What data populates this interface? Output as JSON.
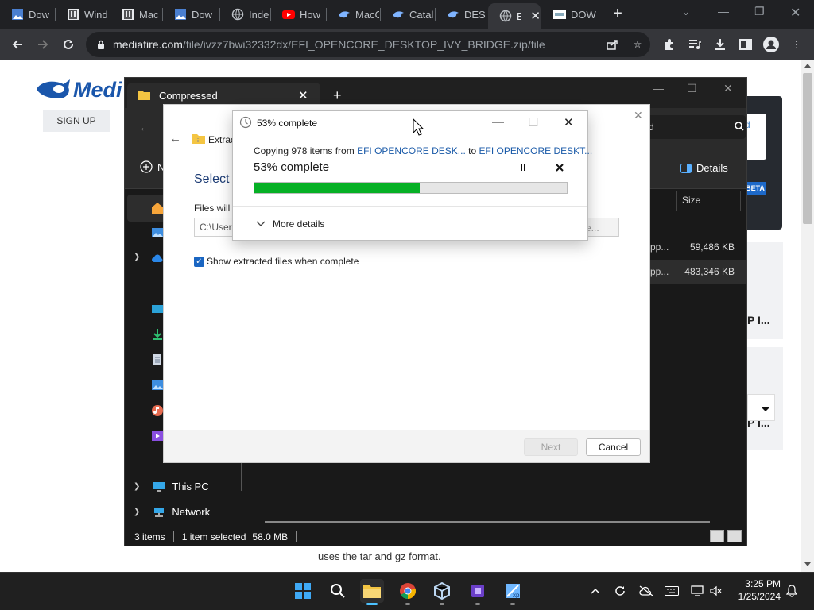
{
  "browser": {
    "tabs": [
      {
        "label": "Dow",
        "icon": "image-favicon"
      },
      {
        "label": "Wind",
        "icon": "archive-favicon"
      },
      {
        "label": "Mac",
        "icon": "archive-favicon"
      },
      {
        "label": "Dow",
        "icon": "image-favicon"
      },
      {
        "label": "Index",
        "icon": "globe-favicon"
      },
      {
        "label": "How",
        "icon": "youtube-favicon"
      },
      {
        "label": "MacC",
        "icon": "bird-favicon"
      },
      {
        "label": "Catal",
        "icon": "bird-favicon"
      },
      {
        "label": "DESK",
        "icon": "bird-favicon"
      },
      {
        "label": "EI",
        "icon": "globe-favicon"
      },
      {
        "label": "DOW",
        "icon": "site-favicon"
      }
    ],
    "active_tab_index": 9,
    "url_host": "mediafire.com",
    "url_path": "/file/ivzz7bwi32332dx/EFI_OPENCORE_DESKTOP_IVY_BRIDGE.zip/file"
  },
  "page": {
    "logo_text": "Medi",
    "signup_label": "SIGN UP",
    "card_text": "d",
    "beta_badge": "BETA",
    "right_text_1": "P I...",
    "right_text_2": "P I...",
    "bottom_text": "uses the tar and gz format."
  },
  "explorer": {
    "tab_title": "Compressed",
    "details_label": "Details",
    "col_size": "Size",
    "rows": [
      {
        "name": "pp...",
        "size": "59,486 KB"
      },
      {
        "name": "pp...",
        "size": "483,346 KB"
      }
    ],
    "nav_new_label": "N",
    "sidebar": {
      "this_pc": "This PC",
      "network": "Network"
    },
    "status": {
      "items": "3 items",
      "selected": "1 item selected",
      "size": "58.0 MB"
    }
  },
  "wizard": {
    "title": "Extrac",
    "heading": "Select a",
    "files_will": "Files will b",
    "path_value": "C:\\Users",
    "browse_label": "se...",
    "show_files_label": "Show extracted files when complete",
    "show_files_checked": true,
    "next_label": "Next",
    "cancel_label": "Cancel"
  },
  "progress": {
    "window_title": "53% complete",
    "copying_prefix": "Copying 978 items from",
    "source": "EFI OPENCORE DESK...",
    "to_word": "to",
    "dest": "EFI OPENCORE DESKT...",
    "percent_label": "53% complete",
    "percent_value": 0.53,
    "more_details": "More details",
    "bar_color": "#06b025"
  },
  "taskbar": {
    "apps": [
      "start-icon",
      "search-icon",
      "file-explorer-icon",
      "chrome-icon",
      "virtualbox-icon",
      "cpu-app-icon",
      "xp-app-icon"
    ],
    "time": "3:25 PM",
    "date": "1/25/2024"
  }
}
